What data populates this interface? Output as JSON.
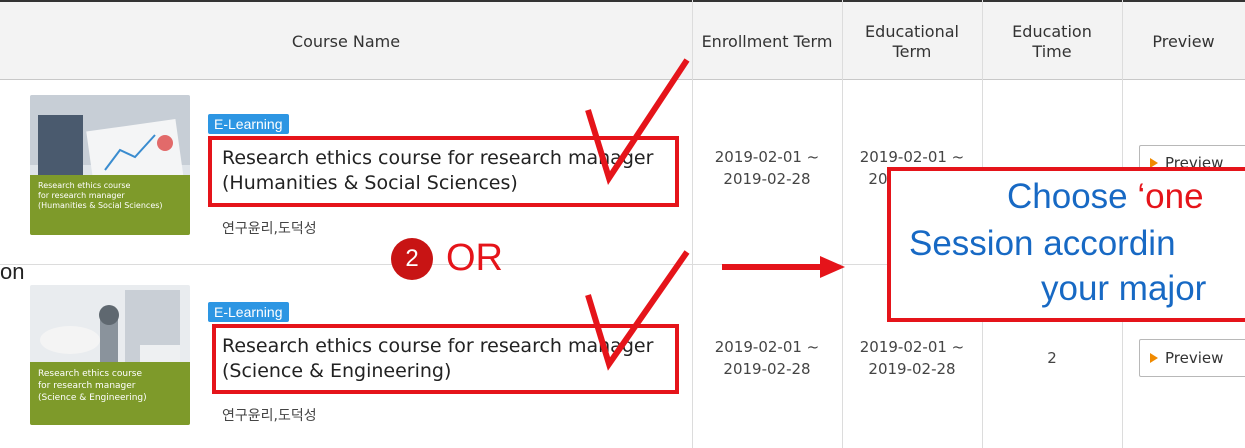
{
  "table": {
    "headers": {
      "course_name": "Course Name",
      "enrollment_term": "Enrollment Term",
      "educational_term_1": "Educational",
      "educational_term_2": "Term",
      "education_time_1": "Education",
      "education_time_2": "Time",
      "preview": "Preview"
    },
    "rows": [
      {
        "thumb_text": [
          "Research ethics course",
          "for research manager",
          "(Humanities & Social Sciences)"
        ],
        "tag": "E-Learning",
        "title_line1": "Research ethics course for research manager",
        "title_line2": "(Humanities & Social Sciences)",
        "category": "연구윤리,도덕성",
        "enroll_start": "2019-02-01 ~",
        "enroll_end": "2019-02-28",
        "edu_start": "2019-02-01 ~",
        "edu_end": "2019-02-28",
        "time": "",
        "preview_label": "Preview"
      },
      {
        "thumb_text": [
          "Research ethics course",
          "for research manager",
          "(Science & Engineering)"
        ],
        "tag": "E-Learning",
        "title_line1": "Research ethics course for research manager",
        "title_line2": "(Science & Engineering)",
        "category": "연구윤리,도덕성",
        "enroll_start": "2019-02-01 ~",
        "enroll_end": "2019-02-28",
        "edu_start": "2019-02-01 ~",
        "edu_end": "2019-02-28",
        "time": "2",
        "preview_label": "Preview"
      }
    ]
  },
  "annotations": {
    "step_number": "2",
    "or_text": "OR",
    "callout_line1_a": "Choose ",
    "callout_line1_b": "‘one",
    "callout_line2": "Session accordin",
    "callout_line3": "your major",
    "left_edge_text": "on",
    "colors": {
      "annotation_red": "#e5141a",
      "callout_blue": "#1769c4",
      "tag_blue": "#2d96e3",
      "thumb_green": "#7e9a2a"
    }
  }
}
